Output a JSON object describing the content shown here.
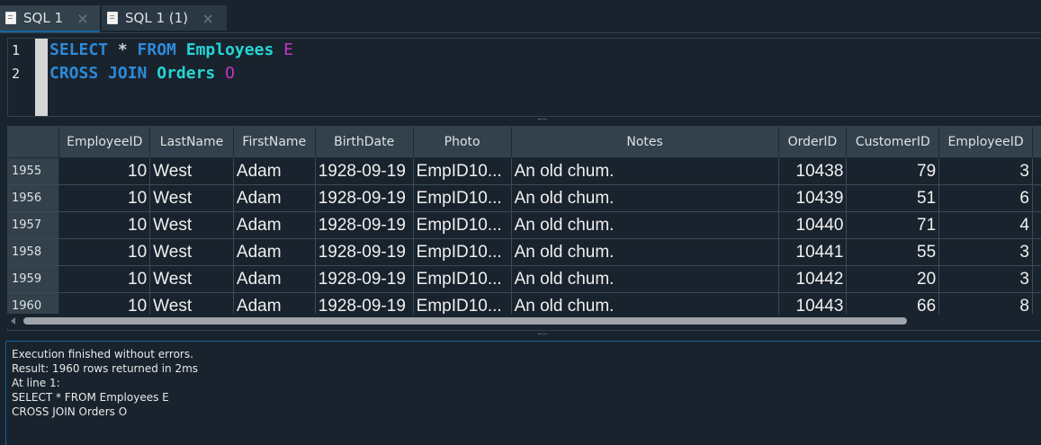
{
  "tabs": [
    {
      "label": "SQL 1",
      "close": "×"
    },
    {
      "label": "SQL 1 (1)",
      "close": "×"
    }
  ],
  "editor": {
    "line_numbers": [
      "1",
      "2"
    ],
    "line1": {
      "kw1": "SELECT",
      "op": " * ",
      "kw2": "FROM",
      "table": "Employees",
      "alias": "E"
    },
    "line2": {
      "kw1": "CROSS",
      "kw2": "JOIN",
      "table": "Orders",
      "alias": "O"
    }
  },
  "grid": {
    "columns": [
      "EmployeeID",
      "LastName",
      "FirstName",
      "BirthDate",
      "Photo",
      "Notes",
      "OrderID",
      "CustomerID",
      "EmployeeID"
    ],
    "rows": [
      {
        "row": "1955",
        "cells": [
          "10",
          "West",
          "Adam",
          "1928-09-19",
          "EmpID10...",
          "An old chum.",
          "10438",
          "79",
          "3"
        ]
      },
      {
        "row": "1956",
        "cells": [
          "10",
          "West",
          "Adam",
          "1928-09-19",
          "EmpID10...",
          "An old chum.",
          "10439",
          "51",
          "6"
        ]
      },
      {
        "row": "1957",
        "cells": [
          "10",
          "West",
          "Adam",
          "1928-09-19",
          "EmpID10...",
          "An old chum.",
          "10440",
          "71",
          "4"
        ]
      },
      {
        "row": "1958",
        "cells": [
          "10",
          "West",
          "Adam",
          "1928-09-19",
          "EmpID10...",
          "An old chum.",
          "10441",
          "55",
          "3"
        ]
      },
      {
        "row": "1959",
        "cells": [
          "10",
          "West",
          "Adam",
          "1928-09-19",
          "EmpID10...",
          "An old chum.",
          "10442",
          "20",
          "3"
        ]
      },
      {
        "row": "1960",
        "cells": [
          "10",
          "West",
          "Adam",
          "1928-09-19",
          "EmpID10...",
          "An old chum.",
          "10443",
          "66",
          "8"
        ]
      }
    ]
  },
  "output": {
    "lines": [
      "Execution finished without errors.",
      "Result: 1960 rows returned in 2ms",
      "At line 1:",
      "SELECT * FROM Employees E",
      "CROSS JOIN Orders O"
    ]
  }
}
